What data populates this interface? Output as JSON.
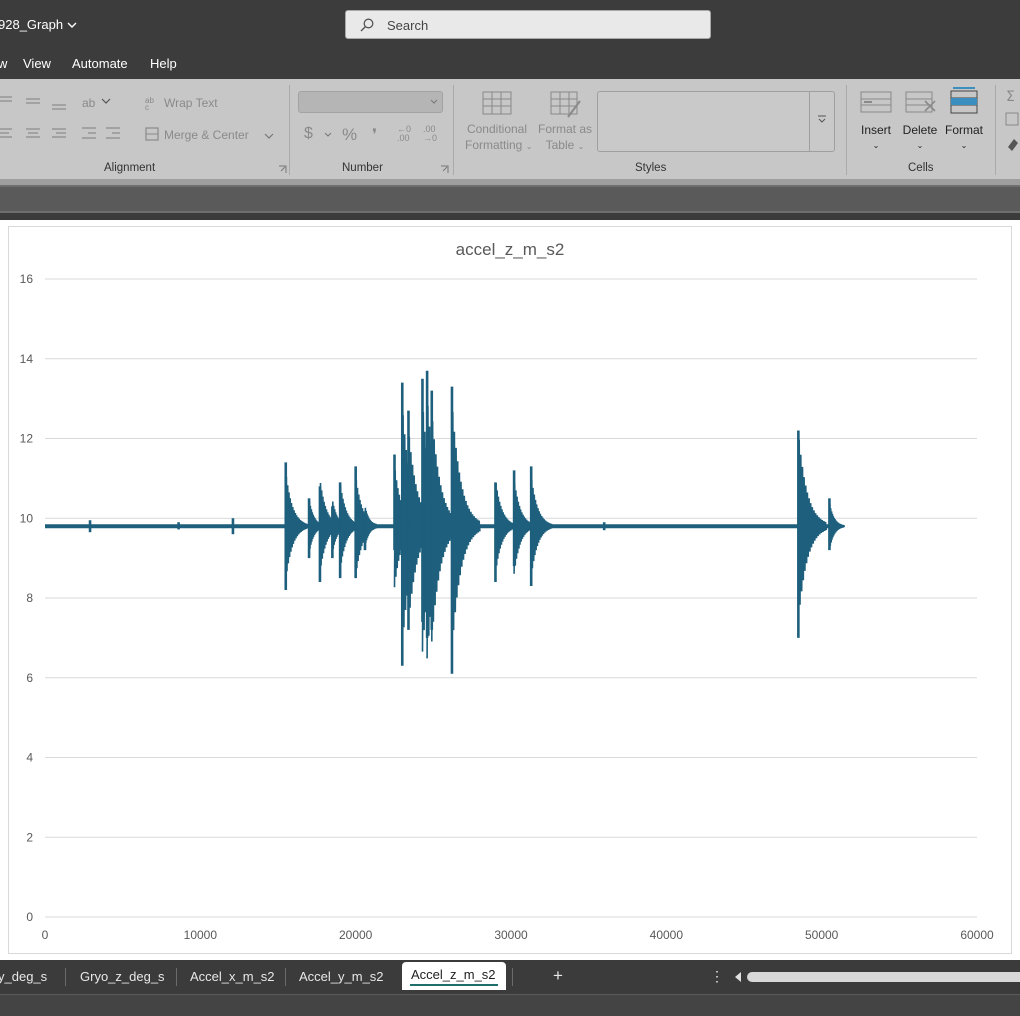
{
  "window": {
    "doc_title": "928_Graph",
    "search_placeholder": "Search"
  },
  "menu": {
    "items": [
      "w",
      "View",
      "Automate",
      "Help"
    ]
  },
  "ribbon": {
    "alignment": {
      "wrap_text": "Wrap Text",
      "merge_center": "Merge & Center",
      "group_label": "Alignment"
    },
    "number": {
      "currency": "$",
      "percent": "%",
      "comma": "❜",
      "inc_decimal": "←0 .00",
      "dec_decimal": ".00 →0",
      "group_label": "Number"
    },
    "styles": {
      "conditional_formatting": [
        "Conditional",
        "Formatting"
      ],
      "format_as_table": [
        "Format as",
        "Table"
      ],
      "group_label": "Styles"
    },
    "cells": {
      "insert": "Insert",
      "delete": "Delete",
      "format": "Format",
      "group_label": "Cells"
    }
  },
  "tabs": {
    "items": [
      "y_deg_s",
      "Gryo_z_deg_s",
      "Accel_x_m_s2",
      "Accel_y_m_s2"
    ],
    "active": "Accel_z_m_s2",
    "add_symbol": "+",
    "more_symbol": "⋮"
  },
  "colors": {
    "series": "#1d5f7c",
    "gridline": "#d9d9d9",
    "accent_tab": "#1f6e6a"
  },
  "chart_data": {
    "type": "line",
    "title": "accel_z_m_s2",
    "xlim": [
      0,
      60000
    ],
    "ylim": [
      0,
      16
    ],
    "xticks": [
      0,
      10000,
      20000,
      30000,
      40000,
      50000,
      60000
    ],
    "yticks": [
      0,
      2,
      4,
      6,
      8,
      10,
      12,
      14,
      16
    ],
    "grid": "horizontal",
    "baseline": 9.8,
    "x_max": 51000,
    "series": [
      {
        "bursts": [
          {
            "x": 2900,
            "max": 9.95,
            "min": 9.65
          },
          {
            "x": 8600,
            "max": 9.9,
            "min": 9.72
          },
          {
            "x": 12100,
            "max": 10.0,
            "min": 9.6
          },
          {
            "x": 15500,
            "max": 11.4,
            "min": 8.2
          },
          {
            "x": 17000,
            "max": 10.5,
            "min": 9.0
          },
          {
            "x": 17700,
            "max": 10.8,
            "min": 8.4
          },
          {
            "x": 18500,
            "max": 10.3,
            "min": 9.0
          },
          {
            "x": 19000,
            "max": 10.9,
            "min": 8.5
          },
          {
            "x": 20000,
            "max": 11.3,
            "min": 8.5
          },
          {
            "x": 20600,
            "max": 10.0,
            "min": 9.2
          },
          {
            "x": 22500,
            "max": 11.6,
            "min": 9.2
          },
          {
            "x": 23000,
            "max": 13.4,
            "min": 6.3
          },
          {
            "x": 23400,
            "max": 12.7,
            "min": 7.2
          },
          {
            "x": 24300,
            "max": 13.5,
            "min": 7.4
          },
          {
            "x": 24600,
            "max": 13.7,
            "min": 7.0
          },
          {
            "x": 24900,
            "max": 13.2,
            "min": 7.2
          },
          {
            "x": 26200,
            "max": 13.3,
            "min": 6.1
          },
          {
            "x": 29000,
            "max": 10.9,
            "min": 8.4
          },
          {
            "x": 30200,
            "max": 11.2,
            "min": 8.8
          },
          {
            "x": 31300,
            "max": 11.3,
            "min": 8.3
          },
          {
            "x": 36000,
            "max": 9.9,
            "min": 9.7
          },
          {
            "x": 48500,
            "max": 12.2,
            "min": 7.0
          },
          {
            "x": 50500,
            "max": 10.5,
            "min": 9.2
          }
        ]
      }
    ]
  }
}
